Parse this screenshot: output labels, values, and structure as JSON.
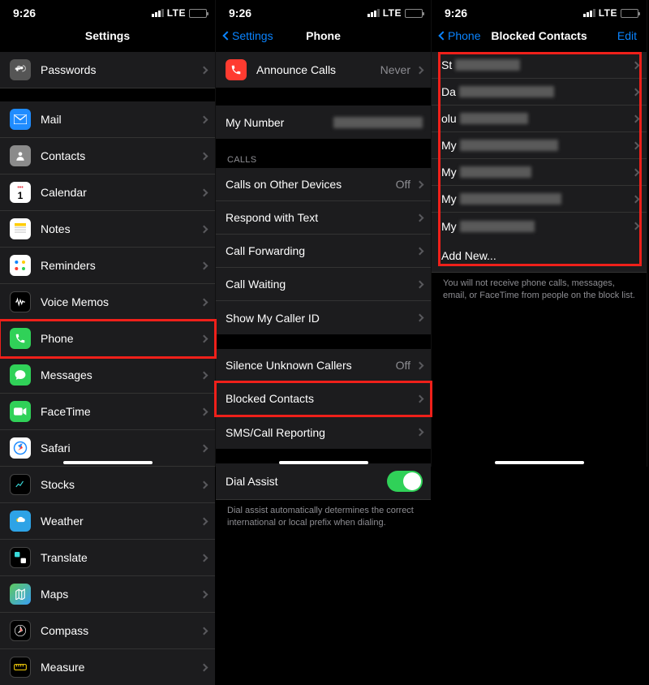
{
  "status": {
    "time": "9:26",
    "carrier_label": "LTE"
  },
  "pane1": {
    "title": "Settings",
    "rows": [
      {
        "id": "passwords",
        "label": "Passwords",
        "icon": "passwords"
      },
      {
        "id": "mail",
        "label": "Mail",
        "icon": "mail"
      },
      {
        "id": "contacts",
        "label": "Contacts",
        "icon": "contacts"
      },
      {
        "id": "calendar",
        "label": "Calendar",
        "icon": "calendar"
      },
      {
        "id": "notes",
        "label": "Notes",
        "icon": "notes"
      },
      {
        "id": "reminders",
        "label": "Reminders",
        "icon": "reminders"
      },
      {
        "id": "voice-memos",
        "label": "Voice Memos",
        "icon": "voice"
      },
      {
        "id": "phone",
        "label": "Phone",
        "icon": "phone",
        "highlight": true
      },
      {
        "id": "messages",
        "label": "Messages",
        "icon": "messages"
      },
      {
        "id": "facetime",
        "label": "FaceTime",
        "icon": "facetime"
      },
      {
        "id": "safari",
        "label": "Safari",
        "icon": "safari"
      },
      {
        "id": "stocks",
        "label": "Stocks",
        "icon": "stocks"
      },
      {
        "id": "weather",
        "label": "Weather",
        "icon": "weather"
      },
      {
        "id": "translate",
        "label": "Translate",
        "icon": "translate"
      },
      {
        "id": "maps",
        "label": "Maps",
        "icon": "maps"
      },
      {
        "id": "compass",
        "label": "Compass",
        "icon": "compass"
      },
      {
        "id": "measure",
        "label": "Measure",
        "icon": "measure"
      }
    ]
  },
  "pane2": {
    "back": "Settings",
    "title": "Phone",
    "announce": {
      "label": "Announce Calls",
      "value": "Never"
    },
    "my_number_label": "My Number",
    "calls_header": "CALLS",
    "rows_calls": [
      {
        "id": "other-devices",
        "label": "Calls on Other Devices",
        "value": "Off"
      },
      {
        "id": "respond",
        "label": "Respond with Text"
      },
      {
        "id": "forwarding",
        "label": "Call Forwarding"
      },
      {
        "id": "waiting",
        "label": "Call Waiting"
      },
      {
        "id": "callerid",
        "label": "Show My Caller ID"
      }
    ],
    "rows_group3": [
      {
        "id": "silence",
        "label": "Silence Unknown Callers",
        "value": "Off"
      },
      {
        "id": "blocked",
        "label": "Blocked Contacts",
        "highlight": true
      },
      {
        "id": "sms-report",
        "label": "SMS/Call Reporting"
      }
    ],
    "dial_assist": {
      "label": "Dial Assist",
      "footer": "Dial assist automatically determines the correct international or local prefix when dialing."
    }
  },
  "pane3": {
    "back": "Phone",
    "title": "Blocked Contacts",
    "edit": "Edit",
    "rows": [
      {
        "prefix": "St"
      },
      {
        "prefix": "Da"
      },
      {
        "prefix": "olu"
      },
      {
        "prefix": "My"
      },
      {
        "prefix": "My"
      },
      {
        "prefix": "My"
      },
      {
        "prefix": "My"
      }
    ],
    "add_new": "Add New...",
    "footer": "You will not receive phone calls, messages, email, or FaceTime from people on the block list."
  }
}
